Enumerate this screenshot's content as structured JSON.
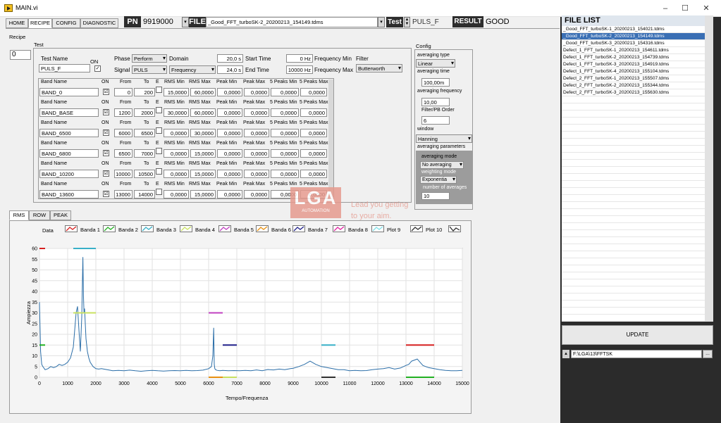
{
  "window": {
    "title": "MAIN.vi",
    "min": "–",
    "max": "☐",
    "close": "✕"
  },
  "tabs": [
    "HOME",
    "RECIPE",
    "CONFIG",
    "DIAGNOSTIC"
  ],
  "header": {
    "pn_label": "PN",
    "pn_value": "9919000",
    "file_label": "FILE",
    "file_value": "_Good_FFT_turboSK-2_20200213_154149.tdms",
    "test_label": "Test",
    "test_value": "PULS_F",
    "result_label": "RESULT",
    "result_value": "GOOD"
  },
  "recipe": {
    "section_label": "Recipe",
    "test_group_label": "Test",
    "index": "0",
    "test_name_label": "Test Name",
    "test_name": "PULS_F",
    "on_label": "ON",
    "phase_label": "Phase",
    "phase_value": "Perform",
    "signal_label": "Signal",
    "signal_value": "PULS",
    "domain_label": "Domain",
    "domain_value": "Frequency",
    "v1": "20,0 s",
    "v2": "24,0 s",
    "start_time_label": "Start Time",
    "start_time": "0 Hz",
    "end_time_label": "End Time",
    "end_time": "10000 Hz",
    "freq_min_label": "Frequency Min",
    "freq_max_label": "Frequency Max",
    "filter_label": "Filter",
    "filter_value": "Butterworth",
    "band_headers": {
      "name": "Band Name",
      "on": "ON",
      "from": "From",
      "to": "To",
      "e": "E",
      "rms_min": "RMS Min",
      "rms_max": "RMS Max",
      "peak_min": "Peak Min",
      "peak_max": "Peak Max",
      "peaks_min": "5 Peaks Min",
      "peaks_max": "5 Peaks Max"
    },
    "bands": [
      {
        "name": "BAND_0",
        "on": "☑",
        "from": "0",
        "to": "200",
        "rms_min": "15,0000",
        "rms_max": "60,0000",
        "peak_min": "0,0000",
        "peak_max": "0,0000",
        "peaks_min": "0,0000",
        "peaks_max": "0,0000"
      },
      {
        "name": "BAND_BASE",
        "on": "☑",
        "from": "1200",
        "to": "2000",
        "rms_min": "30,0000",
        "rms_max": "60,0000",
        "peak_min": "0,0000",
        "peak_max": "0,0000",
        "peaks_min": "0,0000",
        "peaks_max": "0,0000"
      },
      {
        "name": "BAND_6500",
        "on": "☑",
        "from": "6000",
        "to": "6500",
        "rms_min": "0,0000",
        "rms_max": "30,0000",
        "peak_min": "0,0000",
        "peak_max": "0,0000",
        "peaks_min": "0,0000",
        "peaks_max": "0,0000"
      },
      {
        "name": "BAND_6800",
        "on": "☑",
        "from": "6500",
        "to": "7000",
        "rms_min": "0,0000",
        "rms_max": "15,0000",
        "peak_min": "0,0000",
        "peak_max": "0,0000",
        "peaks_min": "0,0000",
        "peaks_max": "0,0000"
      },
      {
        "name": "BAND_10200",
        "on": "☑",
        "from": "10000",
        "to": "10500",
        "rms_min": "0,0000",
        "rms_max": "15,0000",
        "peak_min": "0,0000",
        "peak_max": "0,0000",
        "peaks_min": "0,0000",
        "peaks_max": "0,0000"
      },
      {
        "name": "BAND_13600",
        "on": "☑",
        "from": "13000",
        "to": "14000",
        "rms_min": "0,0000",
        "rms_max": "15,0000",
        "peak_min": "0,0000",
        "peak_max": "0,0000",
        "peaks_min": "0,0000",
        "peaks_max": "0,0000"
      }
    ]
  },
  "config": {
    "title": "Config",
    "avg_type_label": "averaging type",
    "avg_type": "Linear",
    "avg_time_label": "averaging time",
    "avg_time": "100,00m",
    "avg_freq_label": "averaging frequency",
    "avg_freq": "10,00",
    "filter_order_label": "Filter/PB Order",
    "filter_order": "6",
    "window_label": "window",
    "window_value": "Hanning",
    "avg_params_label": "averaging parameters",
    "avg_mode_label": "averaging mode",
    "avg_mode": "No averaging",
    "weight_mode_label": "weighting mode",
    "weight_mode": "Exponentia",
    "num_avg_label": "number of averages",
    "num_avg": "10"
  },
  "watermark": {
    "logo": "LGA",
    "sub": "AUTOMATION",
    "tagline1": "Lead you getting",
    "tagline2": "to your aim."
  },
  "graph_tabs": [
    "RMS",
    "ROW",
    "PEAK"
  ],
  "legend": {
    "title": "Data",
    "items": [
      {
        "name": "Banda 1",
        "color": "#d62020"
      },
      {
        "name": "Banda 2",
        "color": "#22b022"
      },
      {
        "name": "Banda 3",
        "color": "#38b0c8"
      },
      {
        "name": "Banda 4",
        "color": "#c8e060"
      },
      {
        "name": "Banda 5",
        "color": "#c040c0"
      },
      {
        "name": "Banda 6",
        "color": "#e89010"
      },
      {
        "name": "Banda 7",
        "color": "#20208a"
      },
      {
        "name": "Banda 8",
        "color": "#e020a0"
      },
      {
        "name": "Plot 9",
        "color": "#80e0e8"
      },
      {
        "name": "Plot 10",
        "color": "#303030"
      }
    ]
  },
  "chart_data": {
    "type": "line",
    "xlabel": "Tempo/Frequenza",
    "ylabel": "Ampiezza",
    "xlim": [
      0,
      15000
    ],
    "ylim": [
      0,
      60
    ],
    "xticks": [
      "0",
      "1000",
      "2000",
      "3000",
      "4000",
      "5000",
      "6000",
      "7000",
      "8000",
      "9000",
      "10000",
      "11000",
      "12000",
      "13000",
      "14000",
      "15000"
    ],
    "yticks": [
      "0",
      "5",
      "10",
      "15",
      "20",
      "25",
      "30",
      "35",
      "40",
      "45",
      "50",
      "55",
      "60"
    ],
    "series": [
      {
        "name": "Data",
        "color": "#2b6ea8",
        "x": [
          0,
          40,
          80,
          120,
          200,
          300,
          400,
          500,
          600,
          700,
          800,
          900,
          1000,
          1100,
          1200,
          1300,
          1350,
          1400,
          1450,
          1500,
          1540,
          1560,
          1580,
          1600,
          1650,
          1700,
          1750,
          1800,
          1900,
          2000,
          2100,
          2200,
          2400,
          2600,
          2800,
          3000,
          3200,
          3400,
          3600,
          3800,
          4000,
          4200,
          4400,
          4600,
          4800,
          5000,
          5200,
          5400,
          5600,
          5800,
          6000,
          6100,
          6150,
          6180,
          6200,
          6220,
          6250,
          6300,
          6400,
          6500,
          6700,
          6900,
          7100,
          7300,
          7500,
          7700,
          7900,
          8100,
          8300,
          8500,
          8700,
          8900,
          9000,
          9200,
          9400,
          9600,
          9800,
          10000,
          10200,
          10400,
          10600,
          10800,
          11000,
          11200,
          11400,
          11600,
          11800,
          12000,
          12200,
          12400,
          12600,
          12800,
          13000,
          13100,
          13200,
          13300,
          13400,
          13500,
          13600,
          13700,
          13800,
          14000,
          14200,
          14400,
          14600,
          14800,
          15000
        ],
        "y": [
          35,
          12,
          6,
          5,
          3.5,
          4,
          5,
          4.5,
          5,
          6,
          5.5,
          6,
          7,
          9,
          14,
          30,
          33,
          22,
          12,
          28,
          56,
          38,
          30,
          32,
          18,
          12,
          9,
          7,
          5,
          4,
          3.8,
          4,
          3.5,
          3,
          3.2,
          3,
          3.3,
          3,
          2.8,
          3,
          3.2,
          3,
          2.9,
          3,
          3.1,
          3,
          3.2,
          3,
          3.1,
          3.3,
          4,
          5,
          10,
          23,
          6,
          4,
          3.5,
          3.2,
          3,
          3.2,
          3,
          3.1,
          3,
          3.2,
          3,
          3.4,
          3,
          3.6,
          3.4,
          3.8,
          3.5,
          4,
          4.2,
          5,
          6,
          7.5,
          6,
          5,
          4.5,
          4,
          3.5,
          3.5,
          3,
          3.2,
          3,
          3.1,
          3.5,
          3.8,
          4,
          4.5,
          3.8,
          4.3,
          5.5,
          6,
          7.5,
          8,
          8.5,
          7,
          5.5,
          5,
          4.5,
          4,
          3.5,
          3.2,
          3,
          3,
          3.2
        ]
      },
      {
        "name": "Banda 1",
        "color": "#d62020",
        "segments": [
          [
            0,
            200,
            60
          ],
          [
            13000,
            14000,
            15
          ]
        ]
      },
      {
        "name": "Banda 2",
        "color": "#22b022",
        "segments": [
          [
            0,
            200,
            15
          ],
          [
            13000,
            14000,
            0
          ]
        ]
      },
      {
        "name": "Banda 3",
        "color": "#38b0c8",
        "segments": [
          [
            1200,
            2000,
            60
          ],
          [
            10000,
            10500,
            15
          ]
        ]
      },
      {
        "name": "Banda 4",
        "color": "#c8e060",
        "segments": [
          [
            1200,
            2000,
            30
          ],
          [
            6500,
            7000,
            0
          ]
        ]
      },
      {
        "name": "Banda 5",
        "color": "#c040c0",
        "segments": [
          [
            6000,
            6500,
            30
          ]
        ]
      },
      {
        "name": "Banda 6",
        "color": "#e89010",
        "segments": [
          [
            6000,
            6500,
            0
          ]
        ]
      },
      {
        "name": "Banda 7",
        "color": "#20208a",
        "segments": [
          [
            6500,
            7000,
            15
          ]
        ]
      },
      {
        "name": "Plot 10",
        "color": "#303030",
        "segments": [
          [
            10000,
            10500,
            0
          ]
        ]
      }
    ]
  },
  "side": {
    "file_list_title": "FILE LIST",
    "files": [
      "_Good_FFT_turboSK-1_20200213_154021.tdms",
      "_Good_FFT_turboSK-2_20200213_154149.tdms",
      "_Good_FFT_turboSK-3_20200213_154316.tdms",
      "Defect_1_FFT_turboSK-1_20200213_154611.tdms",
      "Defect_1_FFT_turboSK-2_20200213_154739.tdms",
      "Defect_1_FFT_turboSK-3_20200213_154919.tdms",
      "Defect_1_FFT_turboSK-4_20200213_155104.tdms",
      "Defect_2_FFT_turboSK-1_20200213_155507.tdms",
      "Defect_2_FFT_turboSK-2_20200213_155344.tdms",
      "Defect_2_FFT_turboSK-3_20200213_155630.tdms"
    ],
    "selected_index": 1,
    "update_label": "UPDATE",
    "path": "F:\\LGA\\13\\FFTSK",
    "browse": "..."
  }
}
